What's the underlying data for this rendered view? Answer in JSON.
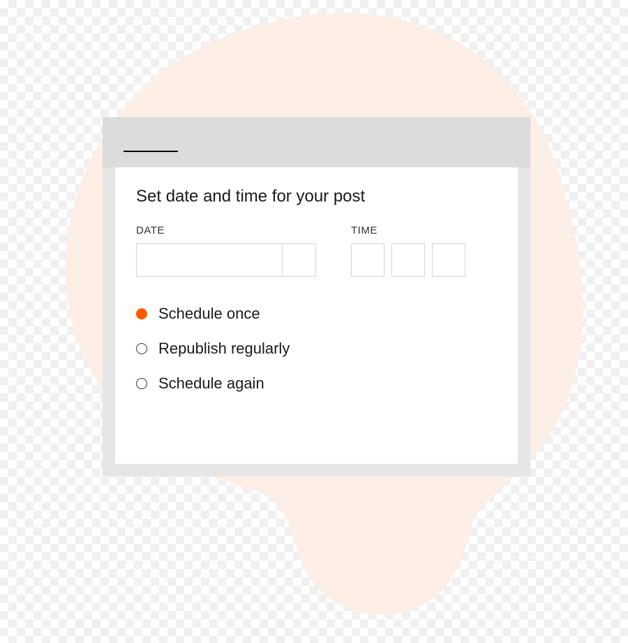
{
  "dialog": {
    "heading": "Set date and time for your post",
    "date_label": "DATE",
    "time_label": "TIME",
    "date_value": "",
    "time_values": [
      "",
      "",
      ""
    ]
  },
  "schedule_options": [
    {
      "label": "Schedule once",
      "selected": true
    },
    {
      "label": "Republish regularly",
      "selected": false
    },
    {
      "label": "Schedule again",
      "selected": false
    }
  ],
  "colors": {
    "accent": "#ff5a00",
    "blob": "#fdefe6"
  }
}
